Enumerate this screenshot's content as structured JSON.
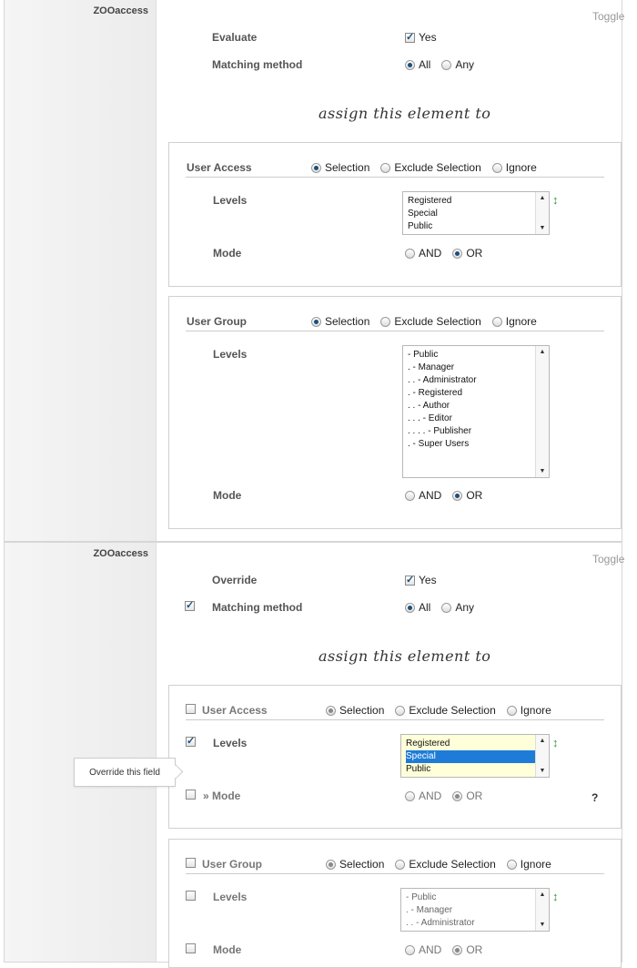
{
  "panel1": {
    "title": "ZOOaccess",
    "toggle": "Toggle",
    "evaluate": {
      "label": "Evaluate",
      "yes": "Yes",
      "checked": true
    },
    "matching": {
      "label": "Matching method",
      "all": "All",
      "any": "Any",
      "selected": "All"
    },
    "assign": "assign this element to",
    "user_access": {
      "title": "User Access",
      "options": [
        "Selection",
        "Exclude Selection",
        "Ignore"
      ],
      "selected": "Selection",
      "levels_label": "Levels",
      "levels": [
        "Registered",
        "Special",
        "Public"
      ],
      "mode_label": "Mode",
      "mode_and": "AND",
      "mode_or": "OR",
      "mode_selected": "OR"
    },
    "user_group": {
      "title": "User Group",
      "options": [
        "Selection",
        "Exclude Selection",
        "Ignore"
      ],
      "selected": "Selection",
      "levels_label": "Levels",
      "levels": [
        "- Public",
        ". - Manager",
        ". . - Administrator",
        ". - Registered",
        ". . - Author",
        ". . . - Editor",
        ". . . . - Publisher",
        ". - Super Users"
      ],
      "mode_label": "Mode",
      "mode_and": "AND",
      "mode_or": "OR",
      "mode_selected": "OR"
    }
  },
  "panel2": {
    "title": "ZOOaccess",
    "toggle": "Toggle",
    "override": {
      "label": "Override",
      "yes": "Yes",
      "checked": true
    },
    "matching": {
      "label": "Matching method",
      "all": "All",
      "any": "Any",
      "selected": "All",
      "override_checked": true
    },
    "assign": "assign this element to",
    "user_access": {
      "title": "User Access",
      "options": [
        "Selection",
        "Exclude Selection",
        "Ignore"
      ],
      "selected": "Selection",
      "levels_label": "Levels",
      "levels": [
        "Registered",
        "Special",
        "Public"
      ],
      "levels_selected": "Special",
      "mode_label": "» Mode",
      "mode_and": "AND",
      "mode_or": "OR",
      "mode_selected": "OR",
      "help": "?"
    },
    "tooltip": "Override this field",
    "user_group": {
      "title": "User Group",
      "options": [
        "Selection",
        "Exclude Selection",
        "Ignore"
      ],
      "selected": "Selection",
      "levels_label": "Levels",
      "levels": [
        "- Public",
        ". - Manager",
        ". . - Administrator"
      ],
      "mode_label": "Mode",
      "mode_and": "AND",
      "mode_or": "OR",
      "mode_selected": "OR"
    }
  }
}
